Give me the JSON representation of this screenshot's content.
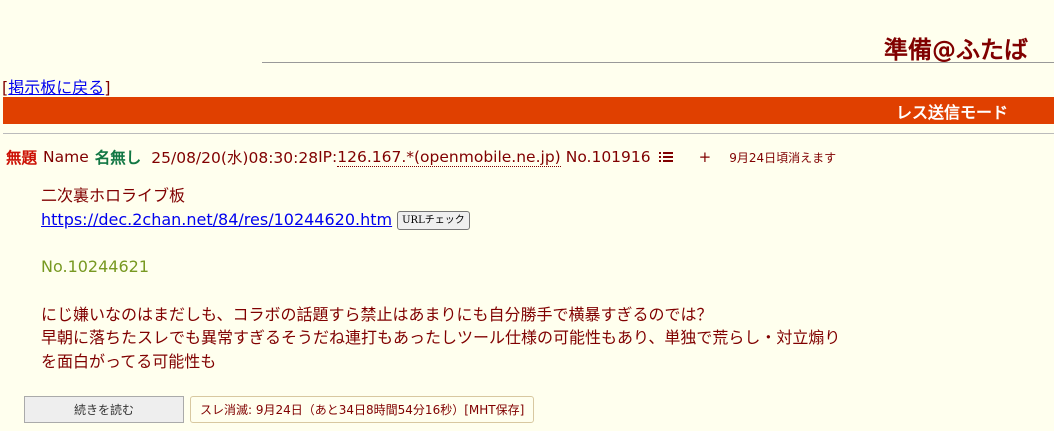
{
  "header": {
    "board_title": "準備@ふたば",
    "back_link_open": "[",
    "back_link_label": "掲示板に戻る",
    "back_link_close": "]",
    "mode_label": "レス送信モード"
  },
  "post": {
    "subject": "無題",
    "name_label": "Name",
    "name": "名無し",
    "date": "25/08/20(水)08:30:28",
    "ip_label": "IP:",
    "ip_host": "126.167.*(openmobile.ne.jp)",
    "number": "No.101916",
    "plus": "+",
    "expire_note": "9月24日頃消えます",
    "body": {
      "line1": "二次裏ホロライブ板",
      "url": "https://dec.2chan.net/84/res/10244620.htm",
      "url_check_label": "URLチェック",
      "quote": "No.10244621",
      "line2": "にじ嫌いなのはまだしも、コラボの話題すら禁止はあまりにも自分勝手で横暴すぎるのでは？",
      "line3": "早朝に落ちたスレでも異常すぎるそうだね連打もあったしツール仕様の可能性もあり、単独で荒らし・対立煽り",
      "line4": "を面白がってる可能性も"
    }
  },
  "footer": {
    "read_more_label": "続きを読む",
    "thread_info": "スレ消滅: 9月24日（あと34日8時間54分16秒）[MHT保存]"
  },
  "colors": {
    "background": "#ffffee",
    "text": "#800000",
    "mode_bar": "#e04000",
    "subject": "#cc1105",
    "name": "#117743",
    "quote": "#789922",
    "link": "#0000ee"
  }
}
